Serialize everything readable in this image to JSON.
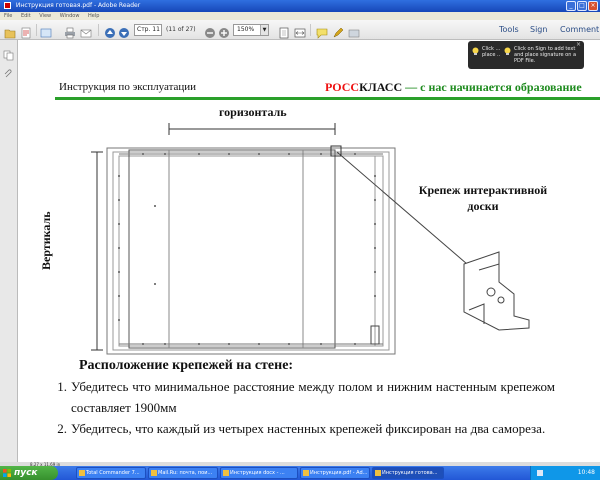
{
  "window": {
    "title": "Инструкция готовая.pdf - Adobe Reader"
  },
  "menubar": [
    "File",
    "Edit",
    "View",
    "Window",
    "Help"
  ],
  "toolbar": {
    "page_label": "Стр. 11",
    "page_count": "(11 of 27)",
    "zoom": "150%",
    "tools": "Tools",
    "sign": "Sign",
    "comment": "Comment"
  },
  "tooltips": [
    {
      "text": "Click ... place ..."
    },
    {
      "text": "Click on Sign to add text and place signature on a PDF File."
    }
  ],
  "document": {
    "header_left": "Инструкция по эксплуатации",
    "brand_red": "РОСС",
    "brand_dark": "КЛАСС",
    "brand_rest": " — с нас начинается образование",
    "figure": {
      "horizontal_label": "горизонталь",
      "vertical_label": "Вертикаль",
      "mount_label_line1": "Крепеж интерактивной",
      "mount_label_line2": "доски"
    },
    "section_title": "Расположение крепежей на стене:",
    "steps": [
      {
        "num": "1.",
        "text": "Убедитесь что минимальное расстояние между полом и нижним настенным крепежом составляет 1900мм"
      },
      {
        "num": "2.",
        "text": "Убедитесь, что каждый из четырех настенных крепежей фиксирован на два самореза."
      }
    ]
  },
  "statusbar": {
    "size": "8,27 x 11,69 in"
  },
  "taskbar": {
    "start": "пуск",
    "tasks": [
      "Total Commander 7...",
      "Mail.Ru: почта, пои...",
      "Инструкция docx - ...",
      "Инструкция.pdf - Ad...",
      "Инструкция готова..."
    ],
    "clock": "10:48"
  }
}
